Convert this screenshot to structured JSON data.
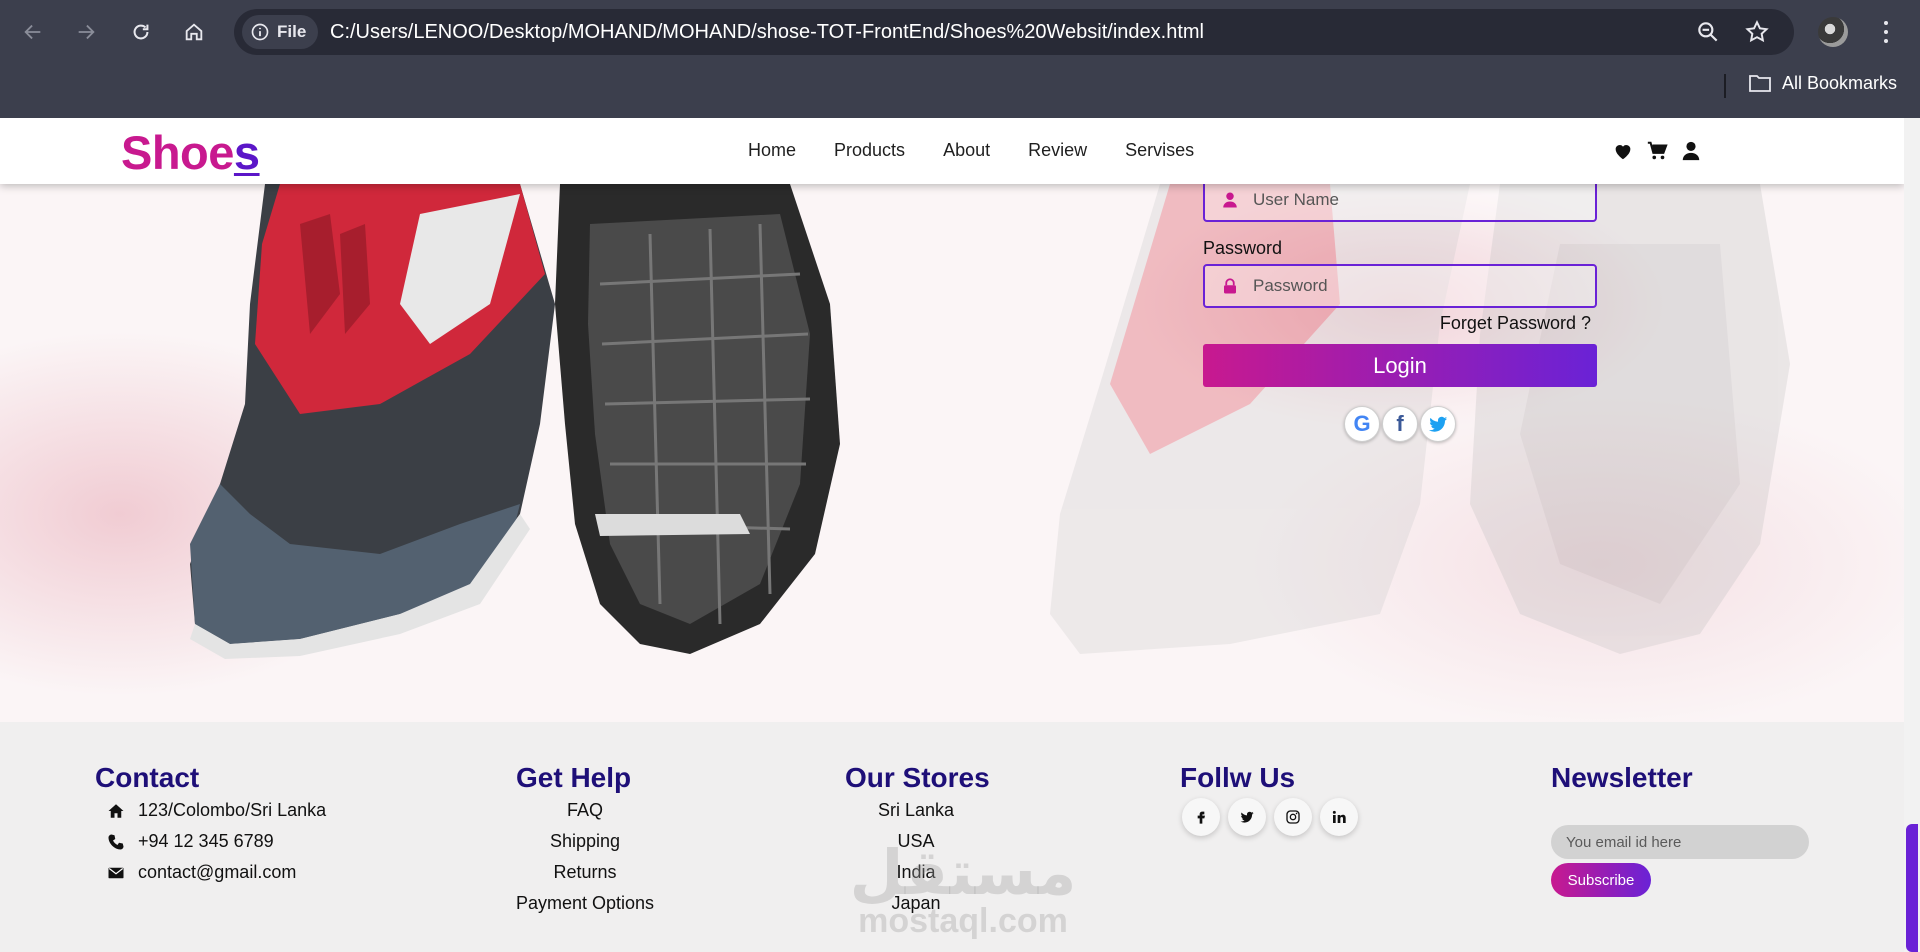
{
  "browser": {
    "site_chip_label": "File",
    "url": "C:/Users/LENOO/Desktop/MOHAND/MOHAND/shose-TOT-FrontEnd/Shoes%20Websit/index.html",
    "bookmarks_label": "All Bookmarks",
    "icons": [
      "back-icon",
      "forward-icon",
      "reload-icon",
      "home-icon",
      "info-icon",
      "zoom-icon",
      "star-icon",
      "profile-avatar",
      "kebab-menu-icon",
      "folder-icon"
    ]
  },
  "site": {
    "logo_main": "Shoe",
    "logo_last": "s",
    "menu": [
      {
        "label": "Home"
      },
      {
        "label": "Products"
      },
      {
        "label": "About"
      },
      {
        "label": "Review"
      },
      {
        "label": "Servises"
      }
    ],
    "header_icons": [
      "heart-icon",
      "cart-icon",
      "user-icon"
    ]
  },
  "login": {
    "username_placeholder": "User Name",
    "password_label": "Password",
    "password_placeholder": "Password",
    "forgot_label": "Forget Password ?",
    "login_label": "Login",
    "social": [
      {
        "name": "google",
        "glyph": "G",
        "color": "#4285f4"
      },
      {
        "name": "facebook",
        "glyph": "f",
        "color": "#3b5998"
      },
      {
        "name": "twitter",
        "glyph": "t",
        "color": "#1da1f2"
      }
    ]
  },
  "footer": {
    "contact": {
      "title": "Contact",
      "address": "123/Colombo/Sri Lanka",
      "phone": "+94 12 345 6789",
      "email": "contact@gmail.com"
    },
    "help": {
      "title": "Get Help",
      "items": [
        "FAQ",
        "Shipping",
        "Returns",
        "Payment Options"
      ]
    },
    "stores": {
      "title": "Our Stores",
      "items": [
        "Sri Lanka",
        "USA",
        "India",
        "Japan"
      ]
    },
    "follow": {
      "title": "Follw Us",
      "icons": [
        "facebook-icon",
        "twitter-icon",
        "instagram-icon",
        "linkedin-icon"
      ]
    },
    "newsletter": {
      "title": "Newsletter",
      "placeholder": "You email id here",
      "button": "Subscribe"
    },
    "watermark_line1": "مستقل",
    "watermark_line2": "mostaql.com"
  },
  "colors": {
    "chrome_bg": "#3c3f4d",
    "omnibox_bg": "#282a36",
    "brand_pink": "#c8198f",
    "brand_purple": "#6a22d6",
    "footer_title": "#1e0f78"
  }
}
